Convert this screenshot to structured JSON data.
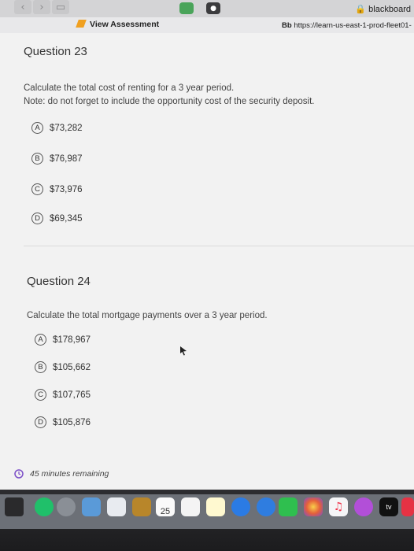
{
  "browser": {
    "top_label": "blackboard",
    "tab_title": "View Assessment",
    "url": "https://learn-us-east-1-prod-fleet01-",
    "url_prefix": "Bb"
  },
  "q23": {
    "title": "Question 23",
    "line1": "Calculate the total cost of renting for a 3 year period.",
    "line2": "Note: do not forget to include the opportunity cost of the security deposit.",
    "options": [
      {
        "letter": "A",
        "text": "$73,282"
      },
      {
        "letter": "B",
        "text": "$76,987"
      },
      {
        "letter": "C",
        "text": "$73,976"
      },
      {
        "letter": "D",
        "text": "$69,345"
      }
    ]
  },
  "q24": {
    "title": "Question 24",
    "line1": "Calculate the total mortgage payments over a 3 year period.",
    "options": [
      {
        "letter": "A",
        "text": "$178,967"
      },
      {
        "letter": "B",
        "text": "$105,662"
      },
      {
        "letter": "C",
        "text": "$107,765"
      },
      {
        "letter": "D",
        "text": "$105,876"
      }
    ]
  },
  "timer": {
    "text": "45 minutes remaining"
  },
  "dock": {
    "calendar_day": "25",
    "tv_label": "tv"
  }
}
